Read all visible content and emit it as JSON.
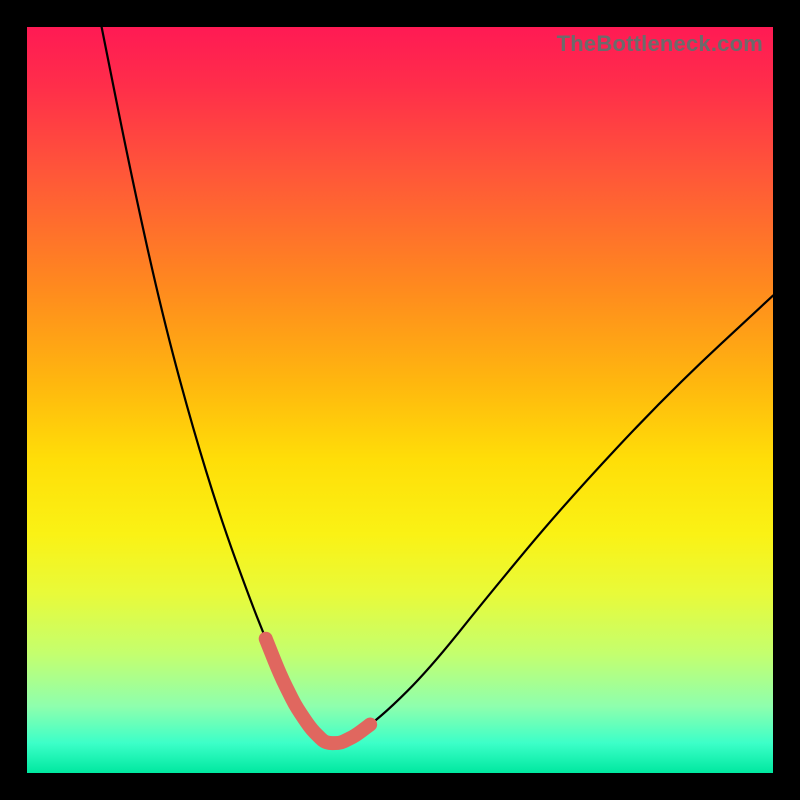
{
  "watermark": "TheBottleneck.com",
  "colors": {
    "page_bg": "#000000",
    "watermark": "#6b6b6b",
    "curve_main": "#000000",
    "curve_highlight": "#e0675f",
    "gradient_stops": [
      {
        "pos": 0.0,
        "hex": "#ff1a54"
      },
      {
        "pos": 0.08,
        "hex": "#ff2e4a"
      },
      {
        "pos": 0.2,
        "hex": "#ff5838"
      },
      {
        "pos": 0.35,
        "hex": "#ff8a1e"
      },
      {
        "pos": 0.48,
        "hex": "#ffb80e"
      },
      {
        "pos": 0.58,
        "hex": "#ffde08"
      },
      {
        "pos": 0.68,
        "hex": "#faf215"
      },
      {
        "pos": 0.76,
        "hex": "#e8fa3a"
      },
      {
        "pos": 0.84,
        "hex": "#c4ff6e"
      },
      {
        "pos": 0.91,
        "hex": "#8fffad"
      },
      {
        "pos": 0.96,
        "hex": "#3cffc8"
      },
      {
        "pos": 1.0,
        "hex": "#00e8a0"
      }
    ]
  },
  "chart_data": {
    "type": "line",
    "title": "",
    "xlabel": "",
    "ylabel": "",
    "xlim": [
      0,
      100
    ],
    "ylim": [
      0,
      100
    ],
    "note": "Axes and ticks are not labeled in the image; x/y treated as 0–100% of plot area. y=0 is the bottom (green) edge, y=100 is the top (red) edge.",
    "series": [
      {
        "name": "bottleneck-curve",
        "x": [
          10,
          14,
          18,
          22,
          26,
          30,
          32,
          34,
          36,
          38,
          40,
          42,
          44,
          48,
          54,
          62,
          72,
          86,
          100
        ],
        "y": [
          100,
          80,
          62,
          47,
          34,
          23,
          18,
          13,
          9,
          6,
          4,
          4,
          5,
          8,
          14,
          24,
          36,
          51,
          64
        ]
      }
    ],
    "highlight_range": {
      "description": "Thick salmon segment near the curve minimum (the recommended match zone).",
      "x_start": 32,
      "x_end": 46,
      "approx_y_at_segment": 6
    },
    "minimum": {
      "x": 41,
      "y": 4
    }
  }
}
